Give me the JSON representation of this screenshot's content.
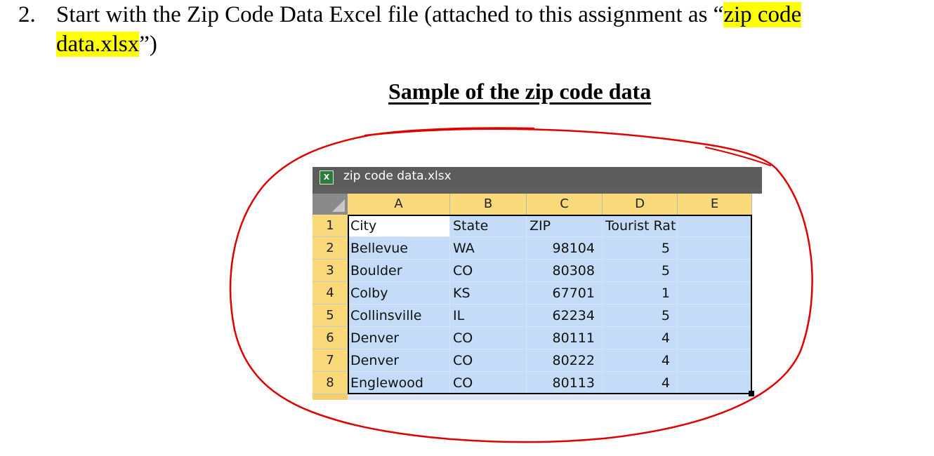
{
  "item2": {
    "number": "2.",
    "text_before": "Start with the Zip Code Data Excel file (attached to this assignment as “",
    "highlight_1": "zip code",
    "highlight_2": "data.xlsx",
    "text_after": "”)"
  },
  "heading": "Sample of the zip code data",
  "excel": {
    "file_name": "zip code data.xlsx",
    "icon": "excel-icon",
    "columns": [
      "A",
      "B",
      "C",
      "D",
      "E"
    ],
    "row_numbers": [
      "1",
      "2",
      "3",
      "4",
      "5",
      "6",
      "7",
      "8"
    ],
    "header_row": [
      "City",
      "State",
      "ZIP",
      "Tourist Rating",
      ""
    ],
    "rows": [
      [
        "Bellevue",
        "WA",
        "98104",
        "5"
      ],
      [
        "Boulder",
        "CO",
        "80308",
        "5"
      ],
      [
        "Colby",
        "KS",
        "67701",
        "1"
      ],
      [
        "Collinsville",
        "IL",
        "62234",
        "5"
      ],
      [
        "Denver",
        "CO",
        "80111",
        "4"
      ],
      [
        "Denver",
        "CO",
        "80222",
        "4"
      ],
      [
        "Englewood",
        "CO",
        "80113",
        "4"
      ]
    ]
  },
  "colors": {
    "highlight": "#ffff00",
    "annotation_circle": "#e00000",
    "column_header": "#f9d97a",
    "selection": "#c4dcf7"
  },
  "annotation": "red-hand-drawn-circle"
}
